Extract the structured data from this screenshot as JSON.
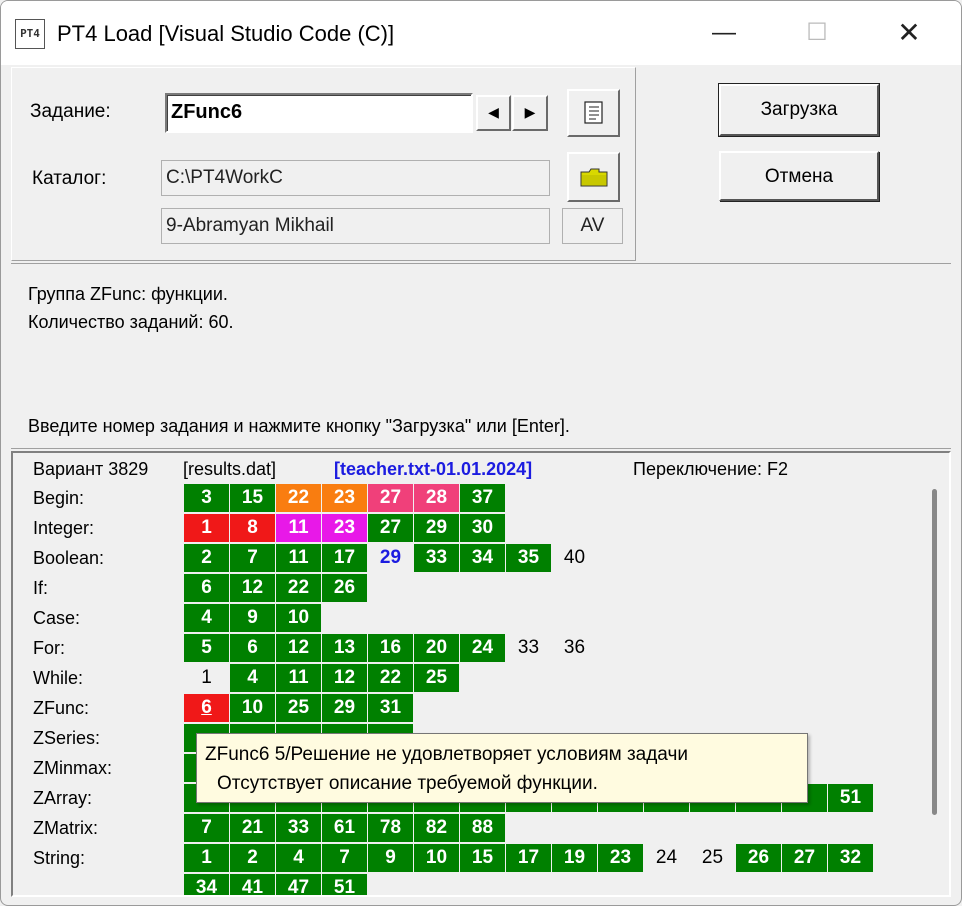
{
  "window": {
    "title": "PT4 Load [Visual Studio Code (C)]",
    "app_icon": "PT4",
    "min": "—",
    "max": "☐",
    "close": "✕"
  },
  "form": {
    "task_label": "Задание:",
    "task_value": "ZFunc6",
    "prev": "◀",
    "next": "▶",
    "catalog_label": "Каталог:",
    "catalog_value": "C:\\PT4WorkC",
    "student": "9-Abramyan Mikhail",
    "av": "AV"
  },
  "buttons": {
    "load": "Загрузка",
    "cancel": "Отмена"
  },
  "info": {
    "line1": "Группа ZFunc: функции.",
    "line2": "Количество заданий: 60.",
    "hint": "Введите номер задания и нажмите кнопку \"Загрузка\" или [Enter]."
  },
  "results": {
    "variant": "Вариант 3829",
    "file": "[results.dat]",
    "teacher": "[teacher.txt-01.01.2024]",
    "switch": "Переключение: F2",
    "colors": {
      "green": "#008000",
      "red": "#f01818",
      "orange": "#f97d10",
      "pink": "#f0407a",
      "magenta": "#e818e8",
      "blue": "#1c1ce0"
    },
    "groups": [
      {
        "name": "Begin:",
        "cells": [
          {
            "v": "3",
            "s": "g"
          },
          {
            "v": "15",
            "s": "g"
          },
          {
            "v": "22",
            "s": "o"
          },
          {
            "v": "23",
            "s": "o"
          },
          {
            "v": "27",
            "s": "p"
          },
          {
            "v": "28",
            "s": "p"
          },
          {
            "v": "37",
            "s": "g"
          }
        ]
      },
      {
        "name": "Integer:",
        "cells": [
          {
            "v": "1",
            "s": "r"
          },
          {
            "v": "8",
            "s": "r"
          },
          {
            "v": "11",
            "s": "m"
          },
          {
            "v": "23",
            "s": "m"
          },
          {
            "v": "27",
            "s": "g"
          },
          {
            "v": "29",
            "s": "g"
          },
          {
            "v": "30",
            "s": "g"
          }
        ]
      },
      {
        "name": "Boolean:",
        "cells": [
          {
            "v": "2",
            "s": "g"
          },
          {
            "v": "7",
            "s": "g"
          },
          {
            "v": "11",
            "s": "g"
          },
          {
            "v": "17",
            "s": "g"
          },
          {
            "v": "29",
            "s": "b"
          },
          {
            "v": "33",
            "s": "g"
          },
          {
            "v": "34",
            "s": "g"
          },
          {
            "v": "35",
            "s": "g"
          },
          {
            "v": "40",
            "s": "n"
          }
        ]
      },
      {
        "name": "If:",
        "cells": [
          {
            "v": "6",
            "s": "g"
          },
          {
            "v": "12",
            "s": "g"
          },
          {
            "v": "22",
            "s": "g"
          },
          {
            "v": "26",
            "s": "g"
          }
        ]
      },
      {
        "name": "Case:",
        "cells": [
          {
            "v": "4",
            "s": "g"
          },
          {
            "v": "9",
            "s": "g"
          },
          {
            "v": "10",
            "s": "g"
          }
        ]
      },
      {
        "name": "For:",
        "cells": [
          {
            "v": "5",
            "s": "g"
          },
          {
            "v": "6",
            "s": "g"
          },
          {
            "v": "12",
            "s": "g"
          },
          {
            "v": "13",
            "s": "g"
          },
          {
            "v": "16",
            "s": "g"
          },
          {
            "v": "20",
            "s": "g"
          },
          {
            "v": "24",
            "s": "g"
          },
          {
            "v": "33",
            "s": "n"
          },
          {
            "v": "36",
            "s": "n"
          }
        ]
      },
      {
        "name": "While:",
        "cells": [
          {
            "v": "1",
            "s": "n"
          },
          {
            "v": "4",
            "s": "g"
          },
          {
            "v": "11",
            "s": "g"
          },
          {
            "v": "12",
            "s": "g"
          },
          {
            "v": "22",
            "s": "g"
          },
          {
            "v": "25",
            "s": "g"
          }
        ]
      },
      {
        "name": "ZFunc:",
        "cells": [
          {
            "v": "6",
            "s": "r u"
          },
          {
            "v": "10",
            "s": "g"
          },
          {
            "v": "25",
            "s": "g"
          },
          {
            "v": "29",
            "s": "g"
          },
          {
            "v": "31",
            "s": "g"
          }
        ]
      },
      {
        "name": "ZSeries:",
        "cells": [
          {
            "v": "",
            "s": "g"
          },
          {
            "v": "",
            "s": "g"
          },
          {
            "v": "",
            "s": "g"
          },
          {
            "v": "",
            "s": "g"
          },
          {
            "v": "",
            "s": "g"
          }
        ]
      },
      {
        "name": "ZMinmax:",
        "cells": [
          {
            "v": "",
            "s": "g"
          }
        ]
      },
      {
        "name": "ZArray:",
        "cells": [
          {
            "v": "",
            "s": "g"
          },
          {
            "v": "",
            "s": "g"
          },
          {
            "v": "",
            "s": "g"
          },
          {
            "v": "",
            "s": "g"
          },
          {
            "v": "",
            "s": "g"
          },
          {
            "v": "",
            "s": "g"
          },
          {
            "v": "",
            "s": "g"
          },
          {
            "v": "",
            "s": "g"
          },
          {
            "v": "",
            "s": "g"
          },
          {
            "v": "",
            "s": "g"
          },
          {
            "v": "",
            "s": "g"
          },
          {
            "v": "",
            "s": "g"
          },
          {
            "v": "",
            "s": "g"
          },
          {
            "v": "",
            "s": "g"
          },
          {
            "v": "51",
            "s": "g"
          }
        ]
      },
      {
        "name": "ZMatrix:",
        "cells": [
          {
            "v": "7",
            "s": "g"
          },
          {
            "v": "21",
            "s": "g"
          },
          {
            "v": "33",
            "s": "g"
          },
          {
            "v": "61",
            "s": "g"
          },
          {
            "v": "78",
            "s": "g"
          },
          {
            "v": "82",
            "s": "g"
          },
          {
            "v": "88",
            "s": "g"
          }
        ]
      },
      {
        "name": "String:",
        "cells": [
          {
            "v": "1",
            "s": "g"
          },
          {
            "v": "2",
            "s": "g"
          },
          {
            "v": "4",
            "s": "g"
          },
          {
            "v": "7",
            "s": "g"
          },
          {
            "v": "9",
            "s": "g"
          },
          {
            "v": "10",
            "s": "g"
          },
          {
            "v": "15",
            "s": "g"
          },
          {
            "v": "17",
            "s": "g"
          },
          {
            "v": "19",
            "s": "g"
          },
          {
            "v": "23",
            "s": "g"
          },
          {
            "v": "24",
            "s": "n"
          },
          {
            "v": "25",
            "s": "n"
          },
          {
            "v": "26",
            "s": "g"
          },
          {
            "v": "27",
            "s": "g"
          },
          {
            "v": "32",
            "s": "g"
          }
        ]
      },
      {
        "name": "",
        "cells": [
          {
            "v": "34",
            "s": "g"
          },
          {
            "v": "41",
            "s": "g"
          },
          {
            "v": "47",
            "s": "g"
          },
          {
            "v": "51",
            "s": "g"
          }
        ]
      }
    ]
  },
  "tooltip": {
    "line1": "ZFunc6 5/Решение не удовлетворяет условиям задачи",
    "line2": "Отсутствует описание требуемой функции."
  }
}
